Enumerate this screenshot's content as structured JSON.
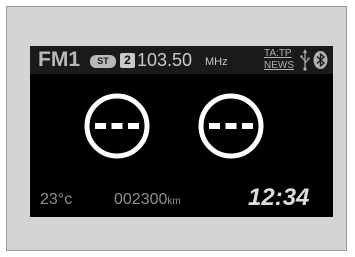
{
  "radio": {
    "band": "FM1",
    "stereo_badge": "ST",
    "preset": "2",
    "frequency": "103.50",
    "frequency_unit": "MHz",
    "ta_tp": "TA:TP",
    "news": "NEWS"
  },
  "dials": {
    "left_value": "---",
    "right_value": "---"
  },
  "status": {
    "temperature": "23°c",
    "odometer": "002300",
    "odometer_unit": "km",
    "clock": "12:34"
  },
  "icons": [
    "usb-icon",
    "bluetooth-icon"
  ],
  "colors": {
    "screen_bg": "#000000",
    "topbar_bg": "#1a1a1a",
    "text_gray": "#8f8f8f",
    "text_light": "#dcdcdc",
    "bezel": "#d4d4d4"
  }
}
